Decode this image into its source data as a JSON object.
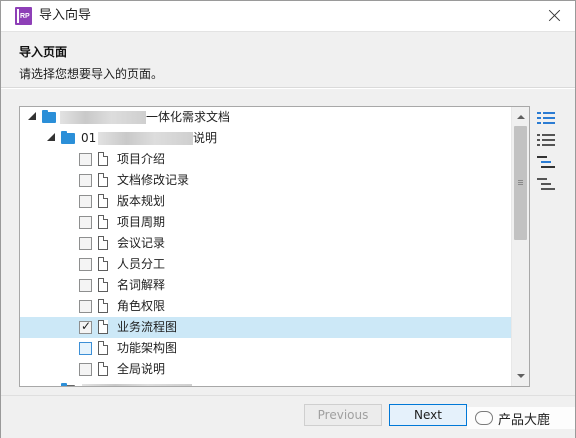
{
  "window": {
    "title": "导入向导",
    "app_icon_text": "RP"
  },
  "header": {
    "title": "导入页面",
    "subtitle": "请选择您想要导入的页面。"
  },
  "tree": {
    "root": {
      "label": "一体化需求文档"
    },
    "group": {
      "label_prefix": "01",
      "label_suffix": "说明"
    },
    "pages": [
      {
        "label": "项目介绍",
        "checked": false
      },
      {
        "label": "文档修改记录",
        "checked": false
      },
      {
        "label": "版本规划",
        "checked": false
      },
      {
        "label": "项目周期",
        "checked": false
      },
      {
        "label": "会议记录",
        "checked": false
      },
      {
        "label": "人员分工",
        "checked": false
      },
      {
        "label": "名词解释",
        "checked": false
      },
      {
        "label": "角色权限",
        "checked": false
      },
      {
        "label": "业务流程图",
        "checked": true,
        "selected": true,
        "check_mark": "✓"
      },
      {
        "label": "功能架构图",
        "checked": false,
        "hovered": true
      },
      {
        "label": "全局说明",
        "checked": false
      }
    ]
  },
  "side_tools": [
    {
      "name": "expand-all-icon"
    },
    {
      "name": "list-view-icon"
    },
    {
      "name": "tree-select-icon"
    },
    {
      "name": "tree-deselect-icon"
    }
  ],
  "buttons": {
    "previous": "Previous",
    "next": "Next"
  },
  "watermark": {
    "text": "产品大鹿"
  },
  "colors": {
    "selection": "#cce8f7",
    "folder": "#2b8fd8",
    "app_icon": "#8e3fb7",
    "primary_border": "#0078d7"
  }
}
